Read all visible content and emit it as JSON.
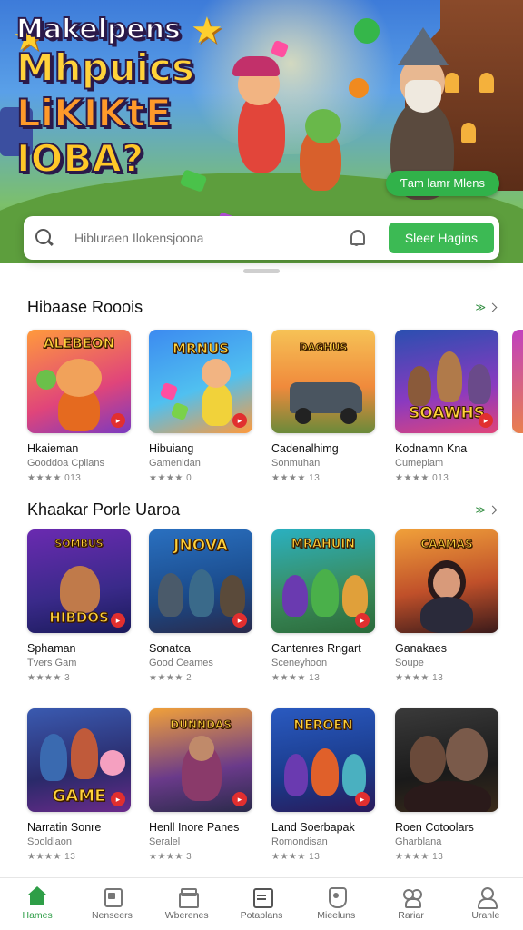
{
  "hero": {
    "title_lines": [
      "Makelpens",
      "Mhpuics",
      "LiKIKtE",
      "IOBA?"
    ],
    "cta_label": "Ƭam lamr Mlens"
  },
  "search": {
    "placeholder": "Hibluraen Ilokensjoona",
    "button_label": "Sleer Hagins"
  },
  "section1": {
    "title": "Hibaase Rooois",
    "see_all": "≫",
    "cards": [
      {
        "name": "Hkaieman",
        "sub": "Gooddoa Cplians",
        "rating": "★★★★ 013",
        "thumb_text": "ALEBEON"
      },
      {
        "name": "Hibuiang",
        "sub": "Gamenidan",
        "rating": "★★★★ 0",
        "thumb_text": "MRNUS"
      },
      {
        "name": "Cadenalhimg",
        "sub": "Sonmuhan",
        "rating": "★★★★ 13",
        "thumb_text": "DAGHUS"
      },
      {
        "name": "Kodnamn Kna",
        "sub": "Cumeplam",
        "rating": "★★★★ 013",
        "thumb_text": "SOAWHS"
      }
    ]
  },
  "section2": {
    "title": "Khaakar Porle Uaroa",
    "see_all": "≫",
    "row1": [
      {
        "name": "Sphaman",
        "sub": "Tvers Gam",
        "rating": "★★★★ 3",
        "thumb_text": "HIBDOS"
      },
      {
        "name": "Sonatca",
        "sub": "Good Ceames",
        "rating": "★★★★ 2",
        "thumb_text": "JNOVA"
      },
      {
        "name": "Cantenres Rngart",
        "sub": "Sceneyhoon",
        "rating": "★★★★ 13",
        "thumb_text": "MRAHUIN"
      },
      {
        "name": "Ganakaes",
        "sub": "Soupe",
        "rating": "★★★★ 13",
        "thumb_text": "CAAMAS"
      }
    ],
    "row2": [
      {
        "name": "Narratin Sonre",
        "sub": "Sooldlaon",
        "rating": "★★★★ 13",
        "thumb_text": "GAME"
      },
      {
        "name": "Henll Inore Panes",
        "sub": "Seralel",
        "rating": "★★★★ 3",
        "thumb_text": "DUNNDAS"
      },
      {
        "name": "Land Soerbapak",
        "sub": "Romondisan",
        "rating": "★★★★ 13",
        "thumb_text": "NEROEN"
      },
      {
        "name": "Roen Cotoolars",
        "sub": "Gharblana",
        "rating": "★★★★ 13",
        "thumb_text": ""
      }
    ]
  },
  "nav": {
    "items": [
      {
        "label": "Hames",
        "icon": "home-icon",
        "active": true
      },
      {
        "label": "Nenseers",
        "icon": "box-icon"
      },
      {
        "label": "Wberenes",
        "icon": "gift-icon"
      },
      {
        "label": "Potaplans",
        "icon": "grid-icon"
      },
      {
        "label": "Mieeluns",
        "icon": "shield-icon"
      },
      {
        "label": "Rariar",
        "icon": "people-icon"
      },
      {
        "label": "Uranle",
        "icon": "profile-icon"
      }
    ]
  },
  "colors": {
    "accent_green": "#3cba54",
    "active_nav": "#2e9e47",
    "badge_red": "#e12f2f"
  }
}
